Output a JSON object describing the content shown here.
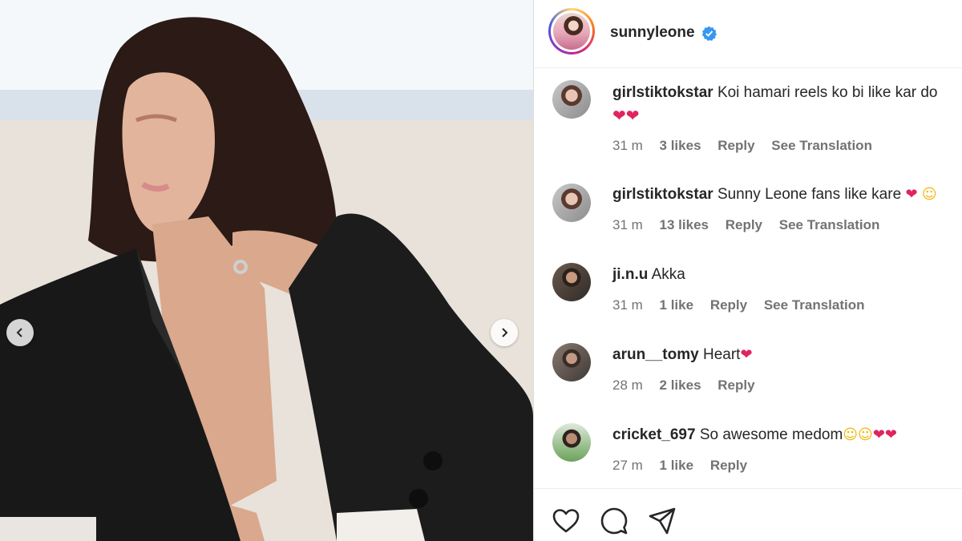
{
  "post": {
    "username": "sunnyleone",
    "verified": true
  },
  "media": {
    "prev_icon": "chevron-left-icon",
    "next_icon": "chevron-right-icon"
  },
  "comments": [
    {
      "username": "girlstiktokstar",
      "text": "Koi hamari reels ko bi like kar do",
      "emoji_line": "❤❤",
      "time": "31 m",
      "likes": "3 likes",
      "reply": "Reply",
      "translate": "See Translation"
    },
    {
      "username": "girlstiktokstar",
      "text": "Sunny Leone fans like kare",
      "emoji_inline": "❤",
      "emoji_inline2": "☺",
      "time": "31 m",
      "likes": "13 likes",
      "reply": "Reply",
      "translate": "See Translation"
    },
    {
      "username": "ji.n.u",
      "text": "Akka",
      "time": "31 m",
      "likes": "1 like",
      "reply": "Reply",
      "translate": "See Translation"
    },
    {
      "username": "arun__tomy",
      "text": "Heart",
      "emoji_inline": "❤",
      "time": "28 m",
      "likes": "2 likes",
      "reply": "Reply"
    },
    {
      "username": "cricket_697",
      "text": "So awesome medom",
      "emoji_inline": "☺☺",
      "emoji_inline2": "❤❤",
      "time": "27 m",
      "likes": "1 like",
      "reply": "Reply"
    }
  ],
  "actions": {
    "like_icon": "heart-icon",
    "comment_icon": "comment-icon",
    "share_icon": "share-icon"
  },
  "colors": {
    "verified_blue": "#3897f0",
    "meta_gray": "#737373",
    "heart_red": "#e0245e"
  }
}
